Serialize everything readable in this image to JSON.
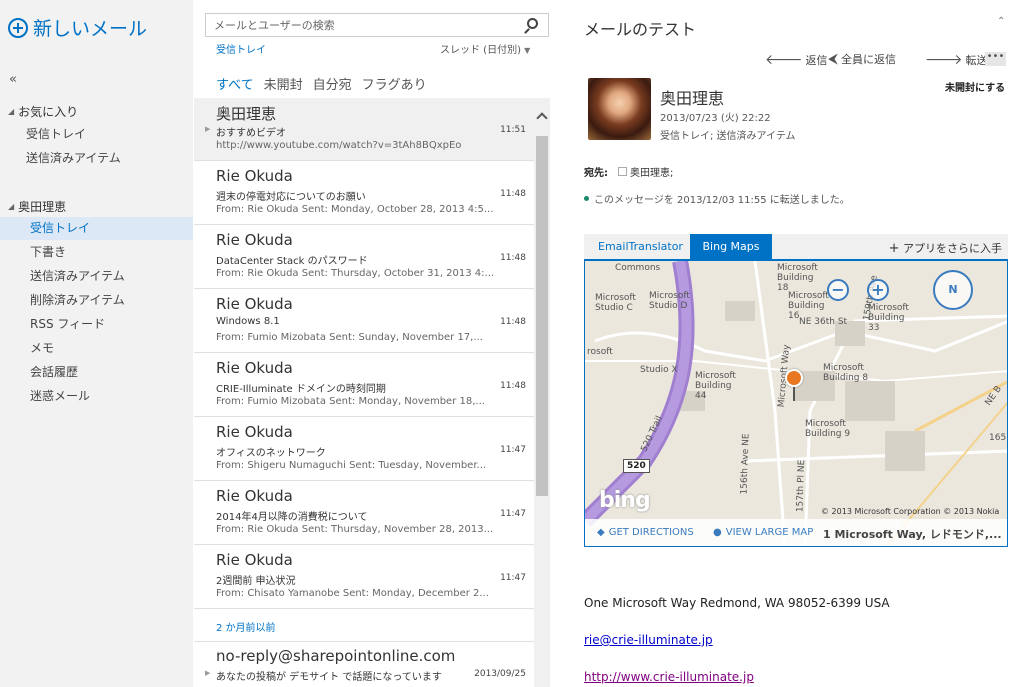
{
  "nav": {
    "new_mail": "新しいメール",
    "collapse": "«",
    "favorites": {
      "label": "お気に入り",
      "items": [
        {
          "label": "受信トレイ"
        },
        {
          "label": "送信済みアイテム"
        }
      ]
    },
    "account": {
      "label": "奥田理恵",
      "items": [
        {
          "label": "受信トレイ",
          "selected": true
        },
        {
          "label": "下書き"
        },
        {
          "label": "送信済みアイテム"
        },
        {
          "label": "削除済みアイテム"
        },
        {
          "label": "RSS フィード"
        },
        {
          "label": "メモ"
        },
        {
          "label": "会話履歴"
        },
        {
          "label": "迷惑メール"
        }
      ]
    }
  },
  "list": {
    "search_placeholder": "メールとユーザーの検索",
    "folder": "受信トレイ",
    "sort": "スレッド (日付別)",
    "filters": [
      "すべて",
      "未開封",
      "自分宛",
      "フラグあり"
    ],
    "messages": [
      {
        "sender": "奥田理恵",
        "subject": "おすすめビデオ",
        "time": "11:51",
        "preview": "http://www.youtube.com/watch?v=3tAh8BQxpEo"
      },
      {
        "sender": "Rie Okuda",
        "subject": "週末の停電対応についてのお願い",
        "time": "11:48",
        "preview": "From: Rie Okuda Sent: Monday, October 28, 2013 4:5..."
      },
      {
        "sender": "Rie Okuda",
        "subject": "DataCenter Stack のパスワード",
        "time": "11:48",
        "preview": "From: Rie Okuda Sent: Thursday, October 31, 2013 4:..."
      },
      {
        "sender": "Rie Okuda",
        "subject": "Windows 8.1",
        "time": "11:48",
        "preview": "From: Fumio Mizobata Sent: Sunday, November 17,..."
      },
      {
        "sender": "Rie Okuda",
        "subject": "CRIE-Illuminate ドメインの時刻同期",
        "time": "11:48",
        "preview": "From: Fumio Mizobata Sent: Monday, November 18,..."
      },
      {
        "sender": "Rie Okuda",
        "subject": "オフィスのネットワーク",
        "time": "11:47",
        "preview": "From: Shigeru Numaguchi Sent: Tuesday, November..."
      },
      {
        "sender": "Rie Okuda",
        "subject": "2014年4月以降の消費税について",
        "time": "11:47",
        "preview": "From: Rie Okuda Sent: Thursday, November 28, 2013..."
      },
      {
        "sender": "Rie Okuda",
        "subject": "2週間前 申込状況",
        "time": "11:47",
        "preview": "From: Chisato Yamanobe Sent: Monday, December 2..."
      }
    ],
    "date_header": "2 か月前以前",
    "older": {
      "sender": "no-reply@sharepointonline.com",
      "subject": "あなたの投稿が デモサイト で話題になっています",
      "time": "2013/09/25"
    }
  },
  "reading": {
    "title": "メールのテスト",
    "actions": {
      "reply": "返信",
      "reply_all": "全員に返信",
      "forward": "転送",
      "more": "•••"
    },
    "sender": "奥田理恵",
    "sent": "2013/07/23 (火) 22:22",
    "folders": "受信トレイ; 送信済みアイテム",
    "mark_unread": "未開封にする",
    "to_label": "宛先:",
    "to_value": "奥田理恵;",
    "forwarded_note": "このメッセージを 2013/12/03 11:55 に転送しました。",
    "apps": {
      "tab1": "EmailTranslator",
      "tab2": "Bing Maps",
      "get_more": "アプリをさらに入手"
    },
    "map": {
      "get_directions": "GET DIRECTIONS",
      "view_large": "VIEW LARGE MAP",
      "address": "1 Microsoft Way, レドモンド,...",
      "copyright": "© 2013 Microsoft Corporation   © 2013 Nokia",
      "bing": "bing",
      "compass": "N",
      "labels": [
        "Commons",
        "Microsoft Studio C",
        "Microsoft Studio D",
        "Microsoft Building 18",
        "Microsoft Building 16",
        "Microsoft Building 33",
        "NE 36th St",
        "159th Ave",
        "rosoft",
        "Studio X",
        "Microsoft Building 44",
        "Microsoft Way",
        "Microsoft Building 8",
        "Microsoft Building 9",
        "520 Trail",
        "520",
        "156th Ave NE",
        "157th Pl NE",
        "NE B",
        "165"
      ]
    },
    "address_line": "One Microsoft Way  Redmond, WA 98052-6399  USA",
    "email": "rie@crie-illuminate.jp",
    "web": "http://www.crie-illuminate.jp"
  }
}
